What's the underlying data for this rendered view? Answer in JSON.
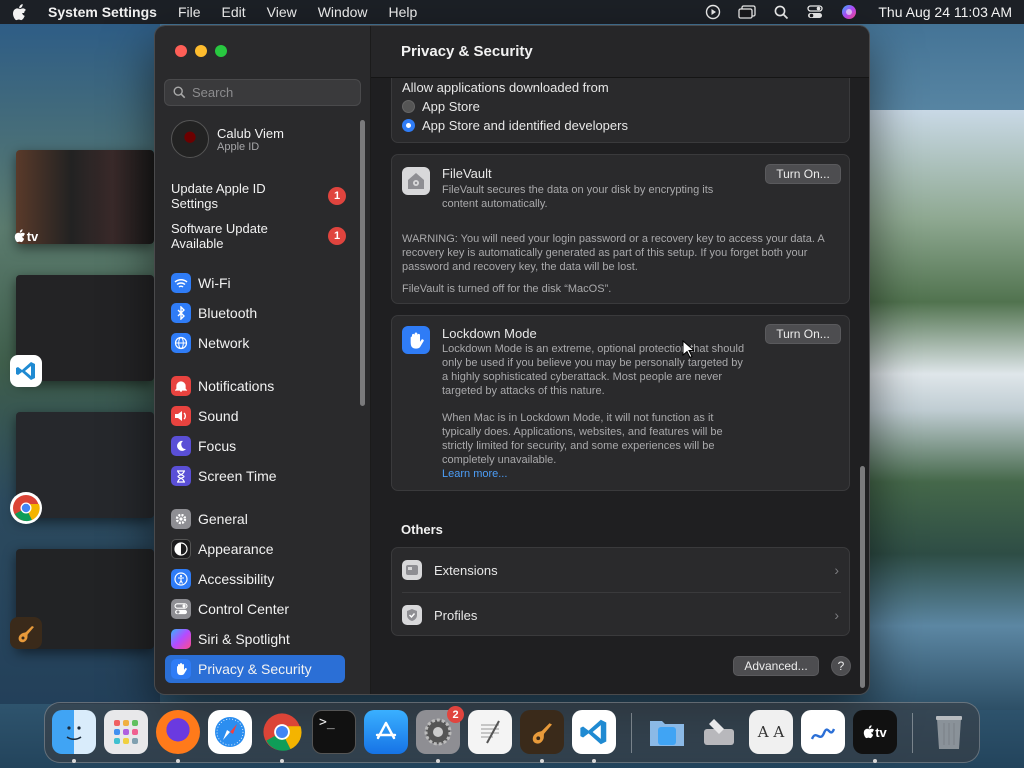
{
  "menubar": {
    "app_name": "System Settings",
    "menus": [
      "File",
      "Edit",
      "View",
      "Window",
      "Help"
    ],
    "clock": "Thu Aug 24  11:03 AM"
  },
  "desktop": {
    "tv_label": "tv"
  },
  "sidebar": {
    "search_placeholder": "Search",
    "account_name": "Calub Viem",
    "account_sub": "Apple ID",
    "alerts": [
      {
        "label": "Update Apple ID Settings",
        "badge": "1"
      },
      {
        "label": "Software Update Available",
        "badge": "1"
      }
    ],
    "items": [
      {
        "label": "Wi-Fi",
        "icon": "wifi-icon",
        "color": "#2f7cf6"
      },
      {
        "label": "Bluetooth",
        "icon": "bluetooth-icon",
        "color": "#2f7cf6"
      },
      {
        "label": "Network",
        "icon": "globe-icon",
        "color": "#2f7cf6"
      },
      {
        "label": "Notifications",
        "icon": "bell-icon",
        "color": "#e8433f"
      },
      {
        "label": "Sound",
        "icon": "speaker-icon",
        "color": "#e8433f"
      },
      {
        "label": "Focus",
        "icon": "moon-icon",
        "color": "#5a4fd6"
      },
      {
        "label": "Screen Time",
        "icon": "hourglass-icon",
        "color": "#5a4fd6"
      },
      {
        "label": "General",
        "icon": "gear-icon",
        "color": "#8e8e93"
      },
      {
        "label": "Appearance",
        "icon": "appearance-icon",
        "color": "#1c1c1e"
      },
      {
        "label": "Accessibility",
        "icon": "accessibility-icon",
        "color": "#2f7cf6"
      },
      {
        "label": "Control Center",
        "icon": "control-center-icon",
        "color": "#8e8e93"
      },
      {
        "label": "Siri & Spotlight",
        "icon": "siri-icon",
        "color": "#b84bd6"
      },
      {
        "label": "Privacy & Security",
        "icon": "hand-icon",
        "color": "#2f7cf6"
      }
    ]
  },
  "main": {
    "title": "Privacy & Security",
    "downloads": {
      "heading": "Allow applications downloaded from",
      "option_1": "App Store",
      "option_2": "App Store and identified developers"
    },
    "filevault": {
      "title": "FileVault",
      "desc": "FileVault secures the data on your disk by encrypting its content automatically.",
      "button": "Turn On...",
      "warning": "WARNING: You will need your login password or a recovery key to access your data. A recovery key is automatically generated as part of this setup. If you forget both your password and recovery key, the data will be lost.",
      "status": "FileVault is turned off for the disk “MacOS”."
    },
    "lockdown": {
      "title": "Lockdown Mode",
      "desc": "Lockdown Mode is an extreme, optional protection that should only be used if you believe you may be personally targeted by a highly sophisticated cyberattack. Most people are never targeted by attacks of this nature.",
      "desc2": "When Mac is in Lockdown Mode, it will not function as it typically does. Applications, websites, and features will be strictly limited for security, and some experiences will be completely unavailable.",
      "link": "Learn more...",
      "button": "Turn On..."
    },
    "others": {
      "title": "Others",
      "rows": [
        "Extensions",
        "Profiles"
      ]
    },
    "advanced_button": "Advanced...",
    "help_button": "?"
  },
  "dock": {
    "settings_badge": "2",
    "tv_label": "tv"
  }
}
